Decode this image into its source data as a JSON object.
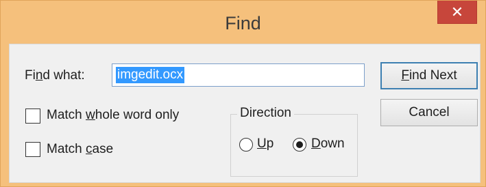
{
  "window": {
    "title": "Find",
    "close_glyph": "✕"
  },
  "find_what": {
    "label_pre": "Fi",
    "label_accel": "n",
    "label_post": "d what:",
    "value": "imgedit.ocx"
  },
  "options": {
    "whole_word": {
      "pre": "Match ",
      "accel": "w",
      "post": "hole word only",
      "checked": false
    },
    "match_case": {
      "pre": "Match ",
      "accel": "c",
      "post": "ase",
      "checked": false
    }
  },
  "direction": {
    "title": "Direction",
    "up": {
      "accel": "U",
      "post": "p",
      "selected": false
    },
    "down": {
      "accel": "D",
      "post": "own",
      "selected": true
    }
  },
  "buttons": {
    "find_next": {
      "accel": "F",
      "post": "ind Next"
    },
    "cancel": {
      "label": "Cancel"
    }
  },
  "colors": {
    "titlebar": "#f5c07c",
    "close_button": "#c7463b",
    "selection": "#3399ff"
  }
}
